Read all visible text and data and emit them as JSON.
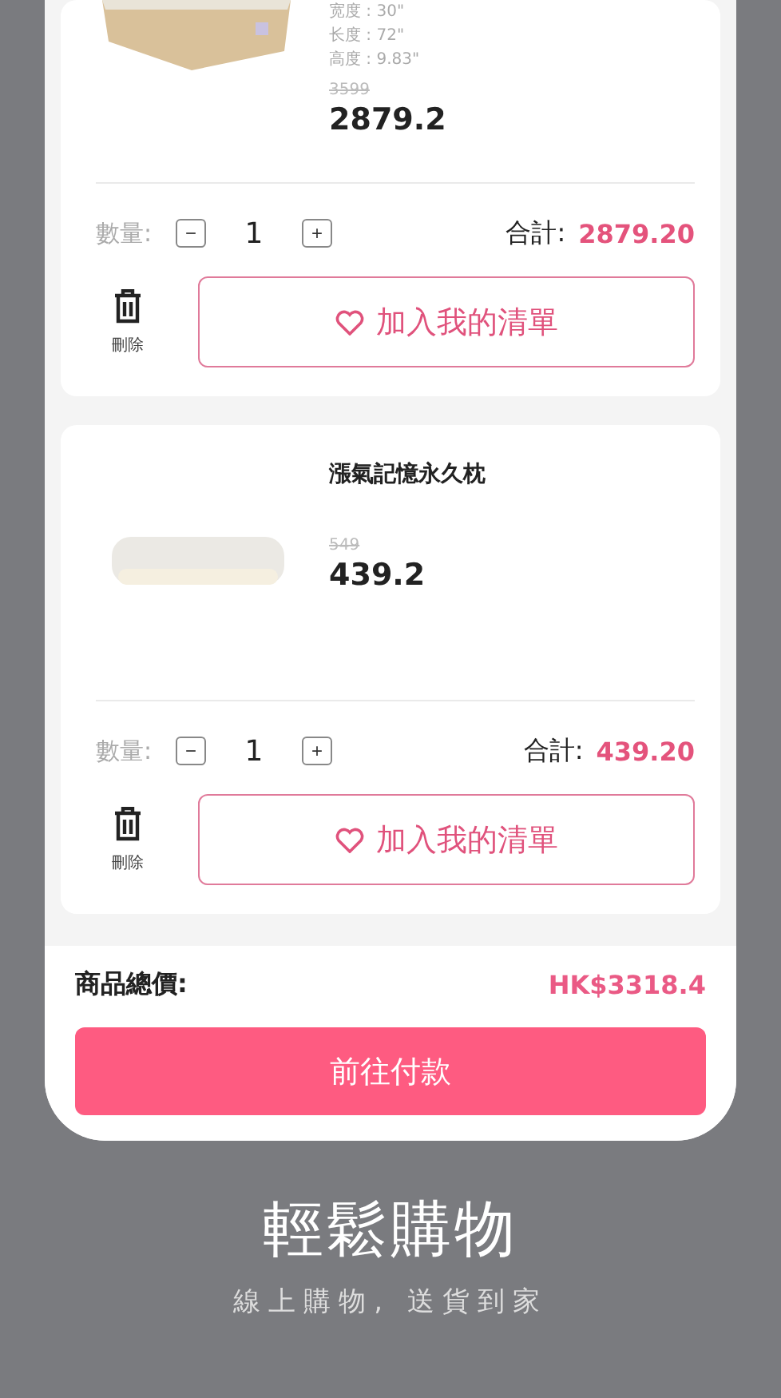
{
  "cart_items": [
    {
      "kind": "mattress",
      "specs": [
        "宽度 : 30\"",
        "长度 : 72\"",
        "高度 : 9.83\""
      ],
      "original_price": "3599",
      "price": "2879.2",
      "quantity_label": "數量:",
      "minus": "−",
      "quantity": "1",
      "plus": "+",
      "subtotal_label": "合計:",
      "subtotal": "2879.20",
      "delete_label": "刪除",
      "wishlist_button": "加入我的清單"
    },
    {
      "kind": "pillow",
      "name": "漲氣記憶永久枕",
      "original_price": "549",
      "price": "439.2",
      "quantity_label": "數量:",
      "minus": "−",
      "quantity": "1",
      "plus": "+",
      "subtotal_label": "合計:",
      "subtotal": "439.20",
      "delete_label": "刪除",
      "wishlist_button": "加入我的清單"
    }
  ],
  "footer": {
    "total_label": "商品總價:",
    "total": "HK$3318.4",
    "checkout_button": "前往付款"
  },
  "caption": {
    "title": "輕鬆購物",
    "subtitle": "線上購物, 送貨到家"
  }
}
